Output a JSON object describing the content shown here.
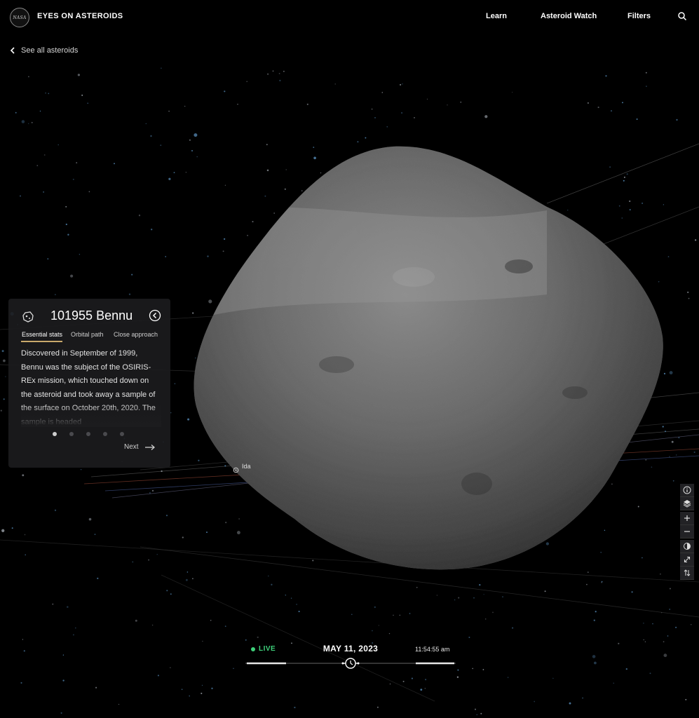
{
  "header": {
    "logo_text": "NASA",
    "brand": "EYES ON ASTEROIDS",
    "nav": [
      {
        "label": "Learn"
      },
      {
        "label": "Asteroid Watch"
      },
      {
        "label": "Filters"
      }
    ],
    "search_icon": "search-icon"
  },
  "back_link": {
    "label": "See all asteroids",
    "icon": "chevron-left-icon"
  },
  "panel": {
    "title": "101955 Bennu",
    "icon": "asteroid-icon",
    "collapse_icon": "chevron-left-circle-icon",
    "tabs": [
      {
        "label": "Essential stats",
        "active": true
      },
      {
        "label": "Orbital path",
        "active": false
      },
      {
        "label": "Close approach",
        "active": false
      }
    ],
    "description": "Discovered in September of 1999, Bennu was the subject of the OSIRIS-REx mission, which touched down on the asteroid and took away a sample of the surface on October 20th, 2020. The sample is headed",
    "dots": {
      "count": 5,
      "active_index": 0
    },
    "next_label": "Next",
    "next_icon": "arrow-right-icon"
  },
  "scene": {
    "body_label": "Ida"
  },
  "toolbar": {
    "tools": [
      {
        "icon": "info-icon"
      },
      {
        "icon": "layers-icon"
      },
      {
        "icon": "zoom-in-icon"
      },
      {
        "icon": "zoom-out-icon"
      },
      {
        "icon": "lighting-icon"
      },
      {
        "icon": "fullscreen-icon"
      },
      {
        "icon": "sort-icon"
      }
    ]
  },
  "time": {
    "live_label": "LIVE",
    "date": "MAY 11, 2023",
    "clock": "11:54:55 am",
    "slider_icon": "clock-icon"
  },
  "colors": {
    "background": "#000000",
    "live_green": "#3ed07a",
    "tab_underline": "#c9a96b",
    "panel_bg": "#1c1c1e"
  }
}
